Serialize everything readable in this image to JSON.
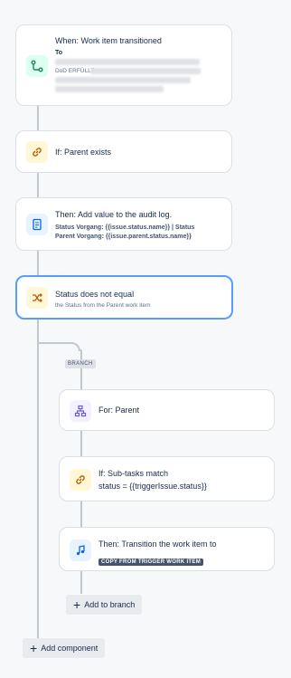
{
  "trigger": {
    "title": "When: Work item transitioned",
    "to_label": "To",
    "status_snippet": "DoD ERFÜLLT,"
  },
  "condition_parent": {
    "title": "If: Parent exists"
  },
  "action_audit": {
    "title": "Then: Add value to the audit log.",
    "line1": "Status Vorgang: {{issue.status.name}} | Status",
    "line2": "Parent Vorgang: {{issue.parent.status.name}}"
  },
  "condition_status": {
    "title": "Status does not equal",
    "description": "the Status from the Parent work item"
  },
  "branch": {
    "badge": "BRANCH",
    "for_parent": {
      "title": "For: Parent"
    },
    "subtasks": {
      "title": "If: Sub-tasks match",
      "detail": "status = {{triggerIssue.status}}"
    },
    "transition": {
      "title": "Then: Transition the work item to",
      "lozenge": "COPY FROM TRIGGER WORK ITEM"
    },
    "add_label": "Add to branch"
  },
  "add_component_label": "Add component",
  "colors": {
    "accent": "#579dff",
    "connector": "#c1c7d0",
    "trigger_icon_bg": "#dcfff1",
    "condition_icon_bg": "#fff7d6",
    "action_icon_bg": "#e9f2ff",
    "branch_icon_bg": "#f3f0ff"
  },
  "icons": {
    "trigger": "transition-icon",
    "condition": "link-icon",
    "audit": "document-icon",
    "compare": "shuffle-icon",
    "branch": "hierarchy-icon",
    "transition": "music-note-icon"
  }
}
